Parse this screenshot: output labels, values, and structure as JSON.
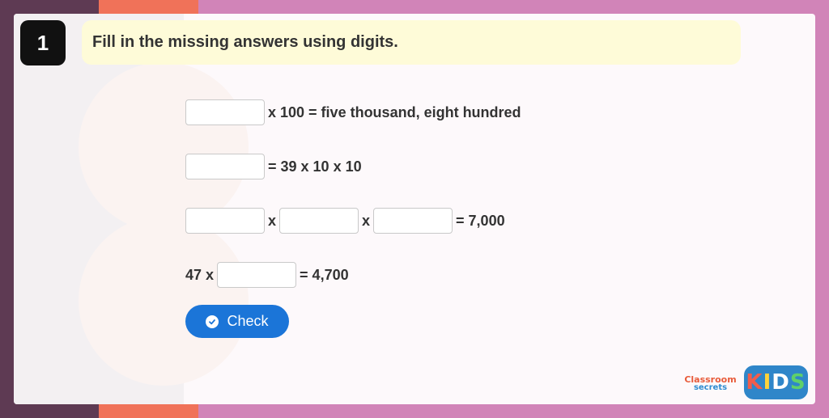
{
  "question": {
    "number": "1",
    "instruction": "Fill in the missing answers using digits."
  },
  "rows": [
    {
      "after": "x 100 = five thousand, eight hundred"
    },
    {
      "after": "= 39 x 10 x 10"
    },
    {
      "sep1": "x",
      "sep2": "x",
      "after": "= 7,000"
    },
    {
      "before": "47 x",
      "after": "= 4,700"
    }
  ],
  "check_button": {
    "label": "Check",
    "icon": "check-circle-icon"
  },
  "logos": {
    "classroom_secrets": [
      "Classroom",
      "secrets"
    ],
    "kids": [
      "K",
      "I",
      "D",
      "S"
    ]
  },
  "colors": {
    "background": "#d184b8",
    "left_band": "#5e3a53",
    "orange_band": "#f07259",
    "title_highlight": "#fefbd8",
    "button": "#1b75d8"
  }
}
